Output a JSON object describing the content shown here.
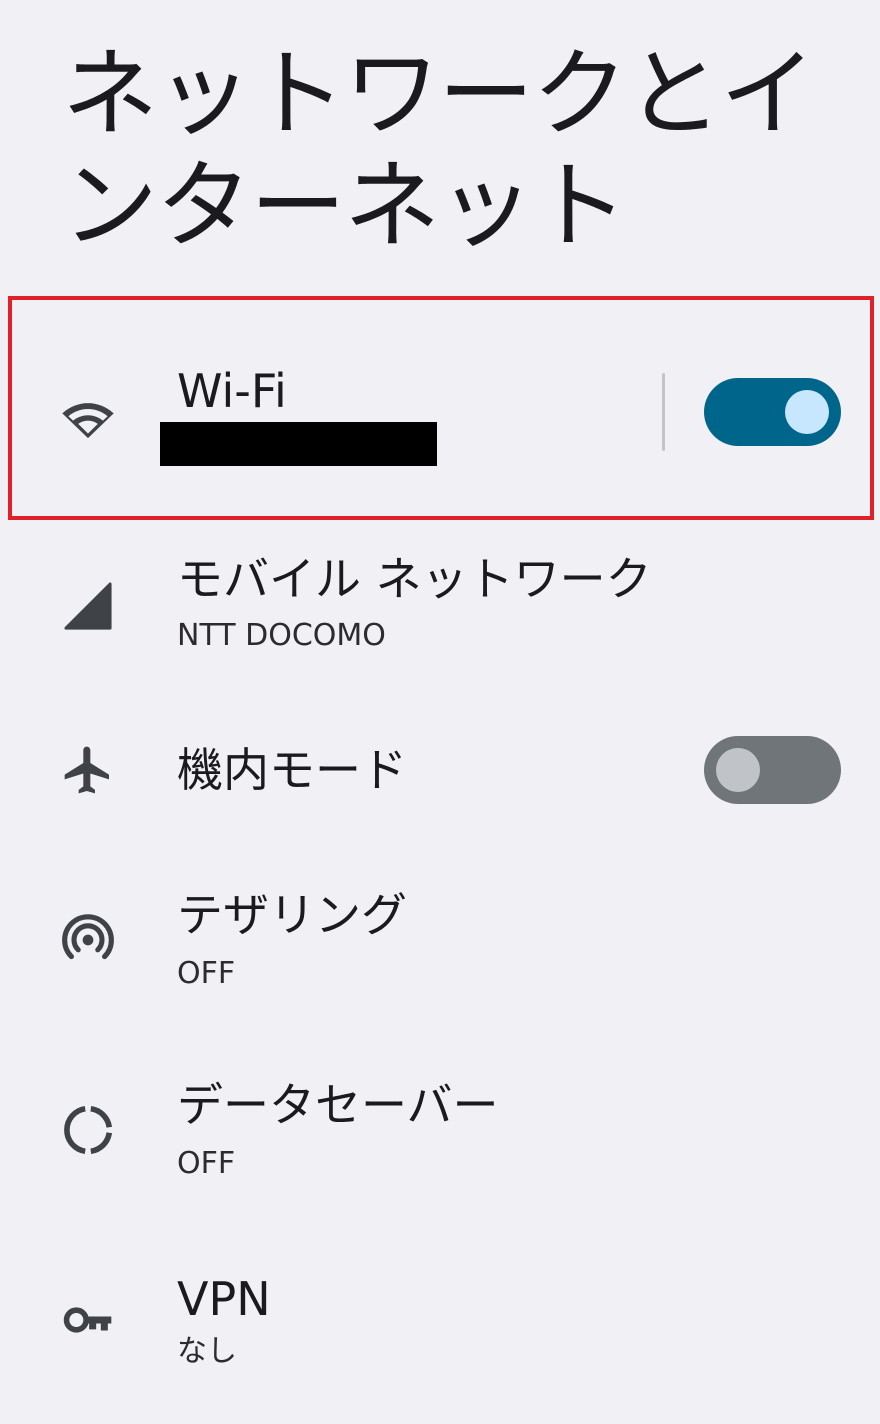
{
  "page_title": "ネットワークとインターネット",
  "items": [
    {
      "id": "wifi",
      "icon": "wifi-icon",
      "title": "Wi-Fi",
      "toggle": true
    },
    {
      "id": "mobile",
      "icon": "cell-signal-icon",
      "title": "モバイル ネットワーク",
      "subtitle": "NTT DOCOMO"
    },
    {
      "id": "airplane",
      "icon": "airplane-icon",
      "title": "機内モード",
      "toggle": false
    },
    {
      "id": "tethering",
      "icon": "hotspot-icon",
      "title": "テザリング",
      "subtitle": "OFF"
    },
    {
      "id": "datasaver",
      "icon": "data-saver-icon",
      "title": "データセーバー",
      "subtitle": "OFF"
    },
    {
      "id": "vpn",
      "icon": "key-icon",
      "title": "VPN",
      "subtitle": "なし"
    }
  ],
  "colors": {
    "toggle_on_track": "#00658a",
    "toggle_on_knob": "#c6e7ff",
    "toggle_off_track": "#707579",
    "highlight": "#e0202a",
    "background": "#f1f0f4"
  }
}
